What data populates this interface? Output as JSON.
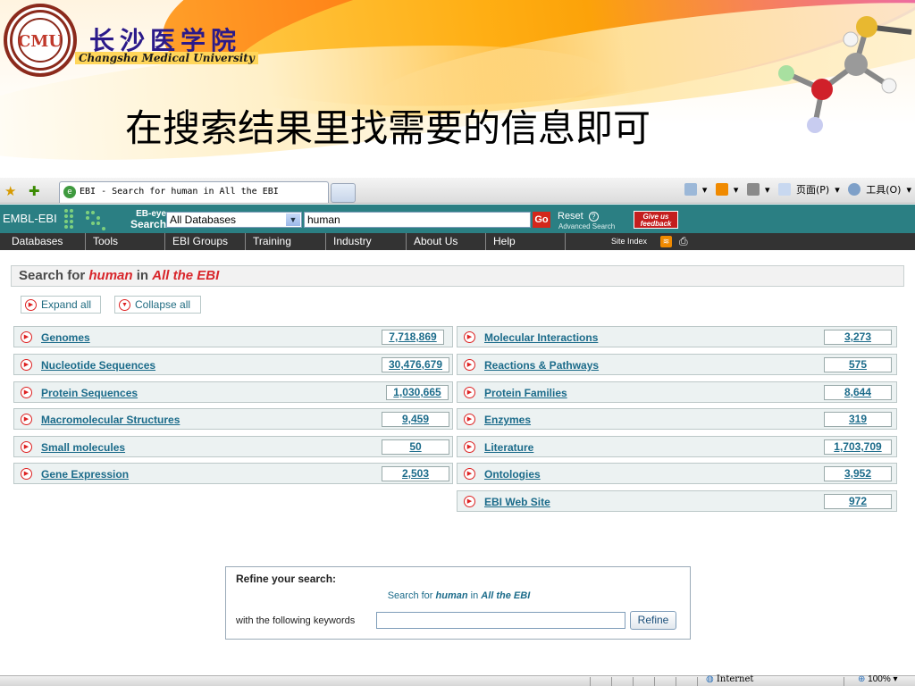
{
  "slide": {
    "univ_cn": "长沙医学院",
    "univ_en": "Changsha Medical University",
    "seal_text": "CMU",
    "title": "在搜索结果里找需要的信息即可"
  },
  "browser": {
    "tab_title": "EBI - Search for human in All the EBI",
    "cmd_page": "页面(P)",
    "cmd_tools": "工具(O)",
    "status_zone": "Internet",
    "zoom": "100%"
  },
  "ebi": {
    "logo": "EMBL-EBI",
    "ebeye_line1": "EB-eye",
    "ebeye_line2": "Search",
    "db_select": "All Databases",
    "query": "human",
    "go": "Go",
    "reset": "Reset",
    "help": "?",
    "advanced": "Advanced Search",
    "feedback_line1": "Give us",
    "feedback_line2": "feedback",
    "nav": [
      "Databases",
      "Tools",
      "EBI Groups",
      "Training",
      "Industry",
      "About Us",
      "Help"
    ],
    "site_index": "Site Index"
  },
  "search": {
    "prefix": "Search for",
    "term": "human",
    "in": "in",
    "scope": "All the EBI",
    "expand_all": "Expand all",
    "collapse_all": "Collapse all"
  },
  "results_left": [
    {
      "label": "Genomes",
      "count": "7,718,869"
    },
    {
      "label": "Nucleotide Sequences",
      "count": "30,476,679"
    },
    {
      "label": "Protein Sequences",
      "count": "1,030,665"
    },
    {
      "label": "Macromolecular Structures",
      "count": "9,459"
    },
    {
      "label": "Small molecules",
      "count": "50"
    },
    {
      "label": "Gene Expression",
      "count": "2,503"
    }
  ],
  "results_right": [
    {
      "label": "Molecular Interactions",
      "count": "3,273"
    },
    {
      "label": "Reactions & Pathways",
      "count": "575"
    },
    {
      "label": "Protein Families",
      "count": "8,644"
    },
    {
      "label": "Enzymes",
      "count": "319"
    },
    {
      "label": "Literature",
      "count": "1,703,709"
    },
    {
      "label": "Ontologies",
      "count": "3,952"
    },
    {
      "label": "EBI Web Site",
      "count": "972"
    }
  ],
  "refine": {
    "title": "Refine your search:",
    "sub_prefix": "Search for",
    "sub_term": "human",
    "sub_in": "in",
    "sub_scope": "All the EBI",
    "label": "with the following keywords",
    "button": "Refine"
  },
  "colors": {
    "ebi_teal": "#2b7f83",
    "nav_dark": "#333333",
    "link_blue": "#1b6b8a",
    "accent_red": "#d8262b"
  }
}
